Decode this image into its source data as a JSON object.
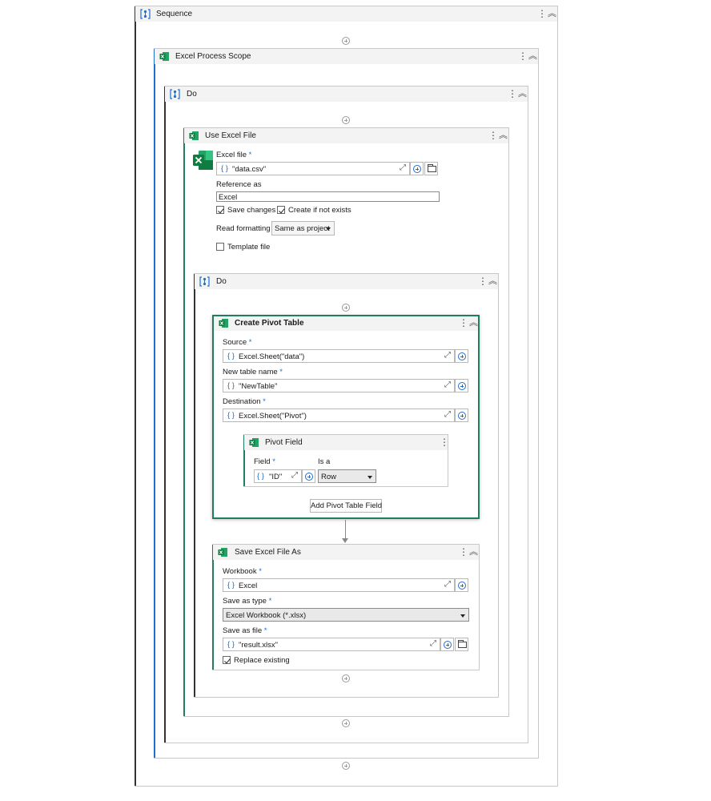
{
  "sequence": {
    "title": "Sequence"
  },
  "excel_process_scope": {
    "title": "Excel Process Scope"
  },
  "do_outer": {
    "title": "Do"
  },
  "use_excel_file": {
    "title": "Use Excel File",
    "excel_file_label": "Excel file",
    "excel_file_value": "\"data.csv\"",
    "reference_as_label": "Reference as",
    "reference_as_value": "Excel",
    "save_changes_label": "Save changes",
    "save_changes_checked": true,
    "create_if_not_exists_label": "Create if not exists",
    "create_if_not_exists_checked": true,
    "read_formatting_label": "Read formatting",
    "read_formatting_value": "Same as project",
    "template_file_label": "Template file",
    "template_file_checked": false
  },
  "do_inner": {
    "title": "Do"
  },
  "create_pivot_table": {
    "title": "Create Pivot Table",
    "source_label": "Source",
    "source_value": "Excel.Sheet(\"data\")",
    "new_table_name_label": "New table name",
    "new_table_name_value": "\"NewTable\"",
    "destination_label": "Destination",
    "destination_value": "Excel.Sheet(\"Pivot\")",
    "pivot_field": {
      "title": "Pivot Field",
      "field_label": "Field",
      "field_value": "\"ID\"",
      "is_a_label": "Is a",
      "is_a_value": "Row"
    },
    "add_button_label": "Add Pivot Table Field"
  },
  "save_excel_file_as": {
    "title": "Save Excel File As",
    "workbook_label": "Workbook",
    "workbook_value": "Excel",
    "save_as_type_label": "Save as type",
    "save_as_type_value": "Excel Workbook (*.xlsx)",
    "save_as_file_label": "Save as file",
    "save_as_file_value": "\"result.xlsx\"",
    "replace_existing_label": "Replace existing",
    "replace_existing_checked": true
  },
  "symbols": {
    "required": "*",
    "brace": "{ }",
    "kebab": "⋮",
    "collapse": "︽",
    "expand": "⤢"
  },
  "icons": {
    "sequence": "sequence-icon",
    "excel": "excel-icon",
    "add": "add-activity-icon"
  },
  "colors": {
    "accent_blue": "#1e6fd0",
    "accent_green": "#1e7d62",
    "excel_green": "#107c41",
    "header_bg": "#f3f3f3"
  }
}
